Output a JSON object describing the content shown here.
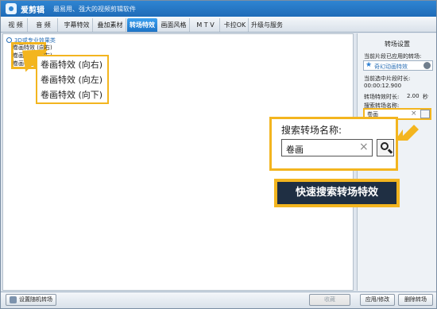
{
  "window": {
    "app_name": "爱剪辑",
    "tagline": "最易用、强大的视频剪辑软件"
  },
  "tabs": [
    {
      "label": "视  频",
      "active": false
    },
    {
      "label": "音  频",
      "active": false
    },
    {
      "label": "字幕特效",
      "active": false
    },
    {
      "label": "叠加素材",
      "active": false
    },
    {
      "label": "转场特效",
      "active": true
    },
    {
      "label": "画面风格",
      "active": false
    },
    {
      "label": "M T V",
      "active": false
    },
    {
      "label": "卡拉OK",
      "active": false
    },
    {
      "label": "升级与服务",
      "active": false
    }
  ],
  "left": {
    "group_title": "3D或专业效果类",
    "small_items": [
      "卷画特效 (向右)",
      "卷画特效 (向左)",
      "卷画特效 (向下)"
    ],
    "zoom_items": [
      "卷画特效 (向右)",
      "卷画特效 (向左)",
      "卷画特效 (向下)"
    ]
  },
  "panel": {
    "title": "转场设置",
    "applied_label": "当前片段已应用的转场:",
    "applied_value": "奇幻动画特效",
    "duration_label": "当前选中片段时长:",
    "duration_value": "00:00:12.900",
    "transition_len_label": "转场特效时长:",
    "transition_len_value": "2.00",
    "transition_len_unit": "秒",
    "search_label": "搜索转场名称:",
    "search_value": "卷画"
  },
  "zoom": {
    "label": "搜索转场名称:",
    "value": "卷画"
  },
  "banner": {
    "text": "快速搜索转场特效"
  },
  "bottom": {
    "random_btn": "设置随机转场",
    "collect_btn": "收藏",
    "apply_btn": "应用/修改",
    "delete_btn": "删除转场"
  },
  "colors": {
    "highlight": "#f3b51f",
    "banner_bg": "#1f2f43",
    "active_tab": "#1d73c6"
  }
}
